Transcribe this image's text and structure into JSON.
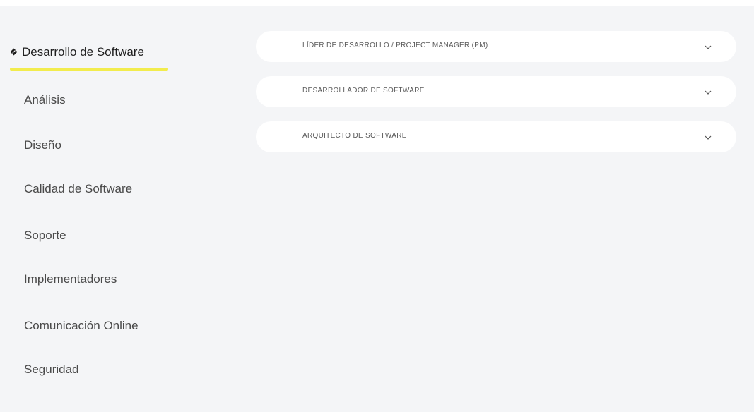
{
  "sidebar": {
    "active_index": 0,
    "items": [
      {
        "label": "Desarrollo de Software"
      },
      {
        "label": "Análisis"
      },
      {
        "label": "Diseño"
      },
      {
        "label": "Calidad de Software"
      },
      {
        "label": "Soporte"
      },
      {
        "label": "Implementadores"
      },
      {
        "label": "Comunicación Online"
      },
      {
        "label": "Seguridad"
      }
    ]
  },
  "accordion": {
    "items": [
      {
        "label": "LÍDER DE DESARROLLO / PROJECT MANAGER (PM)",
        "icon": "chevron-down-icon"
      },
      {
        "label": "DESARROLLADOR DE SOFTWARE",
        "icon": "chevron-down-icon"
      },
      {
        "label": "ARQUITECTO DE SOFTWARE",
        "icon": "chevron-down-icon"
      }
    ]
  },
  "colors": {
    "background": "#f4f5f7",
    "card": "#ffffff",
    "accent_underline": "#f2ec4d",
    "active_text": "#1e1e1e",
    "text": "#4a4a4a"
  }
}
